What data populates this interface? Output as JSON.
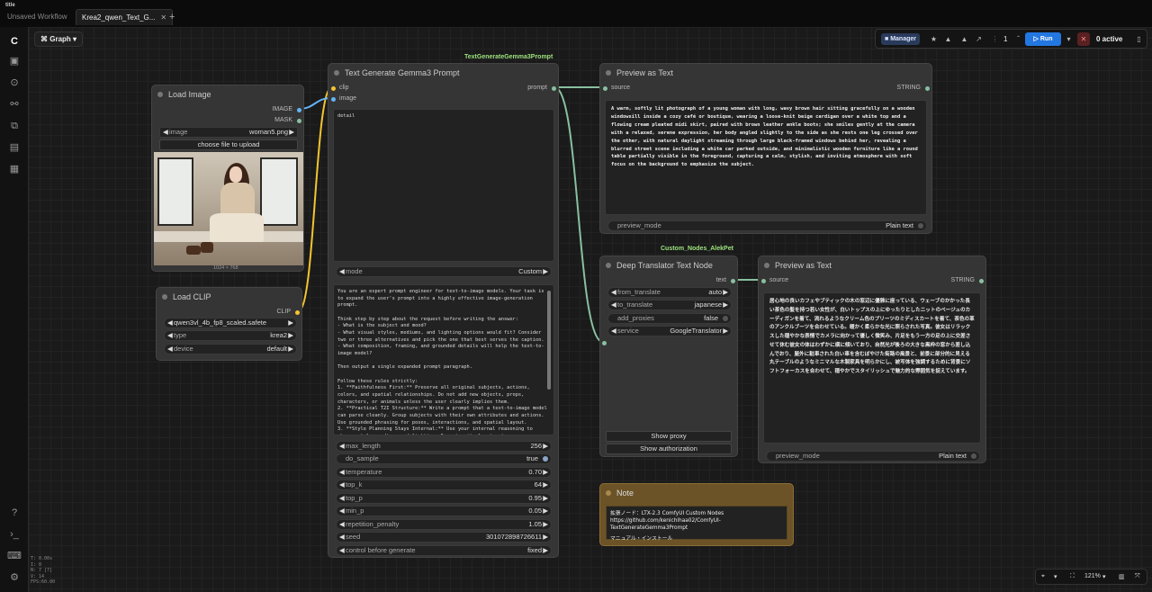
{
  "tabs": {
    "app_small": "title",
    "items": [
      {
        "label": "Unsaved Workflow"
      },
      {
        "label": "Krea2_qwen_Text_G..."
      }
    ],
    "add": "+"
  },
  "canvas_header": {
    "graph_label": "Graph"
  },
  "toolbar": {
    "manager_label": "Manager",
    "queue_count": "1",
    "run_label": "Run",
    "active_label": "0 active"
  },
  "load_image": {
    "title": "Load Image",
    "outputs": [
      "IMAGE",
      "MASK"
    ],
    "image_widget": {
      "name": "image",
      "value": "woman5.png"
    },
    "upload_button": "choose file to upload",
    "image_size": "1024 × 768"
  },
  "load_clip": {
    "title": "Load CLIP",
    "output": "CLIP",
    "clip_name": "qwen3vl_4b_fp8_scaled.safete",
    "type": {
      "name": "type",
      "value": "krea2"
    },
    "device": {
      "name": "device",
      "value": "default"
    }
  },
  "text_gen": {
    "tag": "TextGenerateGemma3Prompt",
    "title": "Text Generate Gemma3 Prompt",
    "inputs": [
      "clip",
      "image"
    ],
    "output": "prompt",
    "prompt_text": "detail",
    "mode": {
      "name": "mode",
      "value": "Custom"
    },
    "system_prompt": "You are an expert prompt engineer for text-to-image models. Your task is to expand the user's prompt into a highly effective image-generation prompt.\n\nThink step by step about the request before writing the answer:\n- What is the subject and mood?\n- What visual styles, mediums, and lighting options would fit? Consider two or three alternatives and pick the one that best serves the caption.\n- What composition, framing, and grounded details will help the text-to-image model?\n\nThen output a single expanded prompt paragraph.\n\nFollow these rules strictly:\n1. **Faithfulness First:** Preserve all original subjects, actions, colors, and spatial relationships. Do not add new objects, props, characters, or animals unless the user clearly implies them.\n2. **Practical T2I Structure:** Write a prompt that a text-to-image model can parse cleanly. Group subjects with their own attributes and actions. Use grounded phrasing for poses, interactions, and spatial layout.\n3. **Style Planning Stays Internal:** Use your internal reasoning to choose style, medium, and lighting. Do not emit planning tags or wrappers in the visible answer body.\n4. **Text Rendering:** If the user requests visible text, quotes, labels, or typography, specify the exact text clearly and wrap requested words in quotes.\n5. **Avoid Over-Specification:** Do not invent highly specific clothing, colors, materials, or scene details unless the input supports them.\n6. **Output:** Write one cohesive paragraph after the thinking block. No",
    "params": [
      {
        "name": "max_length",
        "value": "256"
      },
      {
        "name": "do_sample",
        "value": "true"
      },
      {
        "name": "temperature",
        "value": "0.70"
      },
      {
        "name": "top_k",
        "value": "64"
      },
      {
        "name": "top_p",
        "value": "0.95"
      },
      {
        "name": "min_p",
        "value": "0.05"
      },
      {
        "name": "repetition_penalty",
        "value": "1.05"
      },
      {
        "name": "seed",
        "value": "301072898726611"
      },
      {
        "name": "control before generate",
        "value": "fixed"
      }
    ]
  },
  "preview1": {
    "title": "Preview as Text",
    "input": "source",
    "output": "STRING",
    "text": "A warm, softly lit photograph of a young woman with long, wavy brown hair sitting gracefully on a wooden windowsill inside a cozy café or boutique, wearing a loose-knit beige cardigan over a white top and a flowing cream pleated midi skirt, paired with brown leather ankle boots; she smiles gently at the camera with a relaxed, serene expression, her body angled slightly to the side as she rests one leg crossed over the other, with natural daylight streaming through large black-framed windows behind her, revealing a blurred street scene including a white car parked outside, and minimalistic wooden furniture like a round table partially visible in the foreground, capturing a calm, stylish, and inviting atmosphere with soft focus on the background to emphasize the subject.",
    "mode_label": "preview_mode",
    "mode_value": "Plain text"
  },
  "translator": {
    "tag": "Custom_Nodes_AlekPet",
    "title": "Deep Translator Text Node",
    "output": "text",
    "from": {
      "name": "from_translate",
      "value": "auto"
    },
    "to": {
      "name": "to_translate",
      "value": "japanese"
    },
    "proxies": {
      "name": "add_proxies",
      "value": "false"
    },
    "service": {
      "name": "service",
      "value": "GoogleTranslator"
    },
    "show_proxy": "Show proxy",
    "show_auth": "Show authorization"
  },
  "preview2": {
    "title": "Preview as Text",
    "input": "source",
    "output": "STRING",
    "text": "居心地の良いカフェやブティックの木の窓辺に優雅に座っている、ウェーブのかかった長い茶色の髪を持つ若い女性が、白いトップスの上にゆったりとしたニットのベージュのカーディガンを着て、流れるようなクリーム色のプリーツのミディスカートを着て、茶色の革のアンクルブーツを合わせている。暖かく柔らかな光に照らされた写真。彼女はリラックスした穏やかな表情でカメラに向かって優しく微笑み、片足をもう一方の足の上に交差させて休む彼女の体はわずかに横に傾いており、自然光が後ろの大きな黒枠の窓から差し込んでおり、屋外に駐車された白い車を含むぼやけた街路の風景と、前景に部分的に見える丸テーブルのようなミニマルな木製家具を明らかにし、被写体を強調するために背景にソフトフォーカスを合わせて、穏やかでスタイリッシュで魅力的な雰囲気を捉えています。",
    "mode_label": "preview_mode",
    "mode_value": "Plain text"
  },
  "note": {
    "title": "Note",
    "line1": "拡張ノード：LTX-2.3 ComfyUI Custom Nodes",
    "line2": "https://github.com/kenichihaa02/ComfyUI-TextGenerateGemma3Prompt",
    "line3": "マニュアル・インストール"
  },
  "zoom": {
    "value": "121%"
  },
  "stats": [
    "T: 0.00s",
    "I: 0",
    "N: 7 [7]",
    "V: 14",
    "FPS:60.00"
  ]
}
